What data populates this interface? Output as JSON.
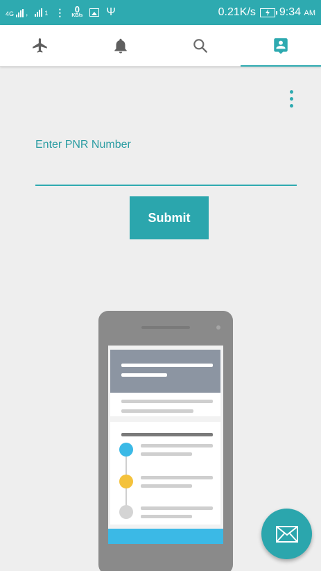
{
  "status_bar": {
    "network": "4G",
    "network_sub": "1",
    "data_rate_value": "0",
    "data_rate_unit": "KB/s",
    "speed": "0.21K/s",
    "time": "9:34",
    "ampm": "AM",
    "icons": [
      "signal-icon",
      "signal-icon",
      "more-dots-icon",
      "image-icon",
      "usb-icon",
      "battery-charging-icon"
    ]
  },
  "tabs": [
    {
      "icon": "airplane-icon",
      "active": false
    },
    {
      "icon": "bell-icon",
      "active": false
    },
    {
      "icon": "search-icon",
      "active": false
    },
    {
      "icon": "contact-card-icon",
      "active": true
    }
  ],
  "form": {
    "label": "Enter PNR Number",
    "value": "",
    "submit_label": "Submit"
  },
  "colors": {
    "accent": "#2eaab0",
    "button": "#2ba6ad",
    "background": "#eeeeee",
    "timeline_blue": "#3bb9e6",
    "timeline_yellow": "#f4c23c",
    "timeline_grey": "#d4d4d4"
  },
  "fab": {
    "icon": "envelope-icon"
  }
}
